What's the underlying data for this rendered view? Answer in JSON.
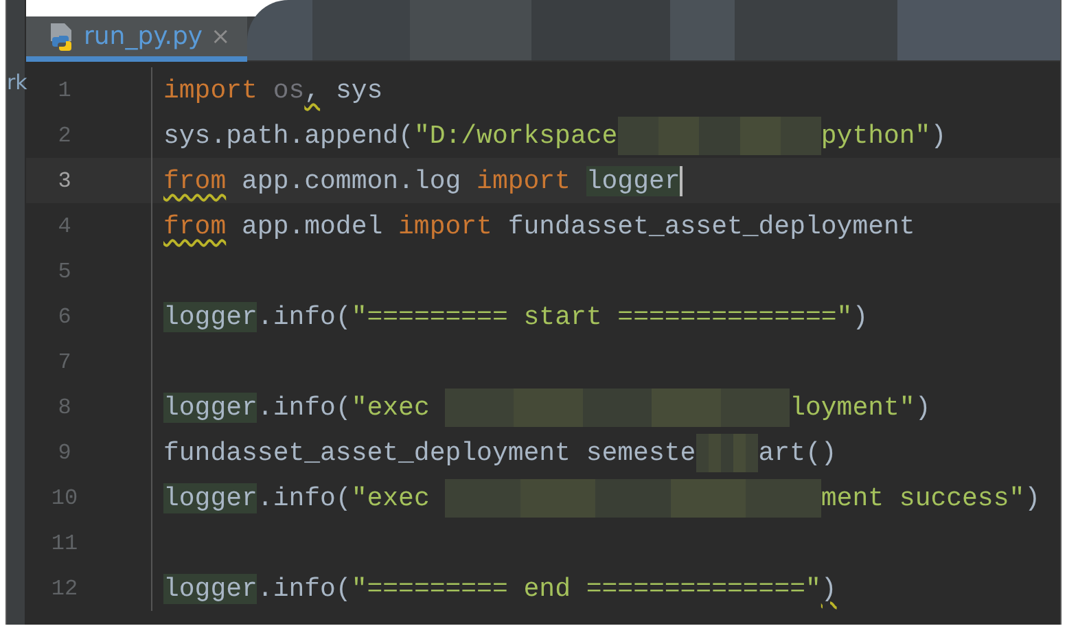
{
  "side_panel": {
    "label": "rk"
  },
  "tabs": [
    {
      "label": "run_py.py",
      "selected": true,
      "close": "×"
    }
  ],
  "editor": {
    "lines": [
      {
        "number": "1",
        "current": false,
        "tokens": [
          {
            "kind": "keyword",
            "text": "import "
          },
          {
            "kind": "unused",
            "text": "os"
          },
          {
            "kind": "plain",
            "text": ",",
            "warn": true
          },
          {
            "kind": "plain",
            "text": " sys"
          }
        ]
      },
      {
        "number": "2",
        "current": false,
        "tokens": [
          {
            "kind": "plain",
            "text": "sys.path.append("
          },
          {
            "kind": "string",
            "text": "\"D:/workspace"
          },
          {
            "kind": "blurmid"
          },
          {
            "kind": "string",
            "text": "python\""
          },
          {
            "kind": "plain",
            "text": ")"
          }
        ]
      },
      {
        "number": "3",
        "current": true,
        "tokens": [
          {
            "kind": "keyword",
            "text": "from",
            "warn": true
          },
          {
            "kind": "plain",
            "text": " app.common.log "
          },
          {
            "kind": "keyword",
            "text": "import "
          },
          {
            "kind": "plain",
            "text": "logger",
            "highlight": true,
            "cursor": true
          }
        ]
      },
      {
        "number": "4",
        "current": false,
        "tokens": [
          {
            "kind": "keyword",
            "text": "from",
            "warn": true
          },
          {
            "kind": "plain",
            "text": " app.model "
          },
          {
            "kind": "keyword",
            "text": "import"
          },
          {
            "kind": "plain",
            "text": " fundasset_asset_deployment"
          }
        ]
      },
      {
        "number": "5",
        "current": false
      },
      {
        "number": "6",
        "current": false,
        "tokens": [
          {
            "kind": "plain",
            "text": "logger",
            "highlight": true
          },
          {
            "kind": "plain",
            "text": ".info("
          },
          {
            "kind": "string",
            "text": "\"========= start ==============\""
          },
          {
            "kind": "plain",
            "text": ")"
          }
        ]
      },
      {
        "number": "7",
        "current": false
      },
      {
        "number": "8",
        "current": false,
        "tokens": [
          {
            "kind": "plain",
            "text": "logger",
            "highlight": true
          },
          {
            "kind": "plain",
            "text": ".info("
          },
          {
            "kind": "string",
            "text": "\"exec "
          },
          {
            "kind": "blurlong"
          },
          {
            "kind": "string",
            "text": "loyment\""
          },
          {
            "kind": "plain",
            "text": ")"
          }
        ]
      },
      {
        "number": "9",
        "current": false,
        "tokens": [
          {
            "kind": "plain",
            "text": "fundasset_asset_deployment semeste"
          },
          {
            "kind": "blurshort"
          },
          {
            "kind": "plain",
            "text": "art()"
          }
        ]
      },
      {
        "number": "10",
        "current": false,
        "tokens": [
          {
            "kind": "plain",
            "text": "logger",
            "highlight": true
          },
          {
            "kind": "plain",
            "text": ".info("
          },
          {
            "kind": "string",
            "text": "\"exec "
          },
          {
            "kind": "blurwide"
          },
          {
            "kind": "string",
            "text": "ment success\""
          },
          {
            "kind": "plain",
            "text": ")"
          }
        ]
      },
      {
        "number": "11",
        "current": false
      },
      {
        "number": "12",
        "current": false,
        "tokens": [
          {
            "kind": "plain",
            "text": "logger",
            "highlight": true
          },
          {
            "kind": "plain",
            "text": ".info("
          },
          {
            "kind": "string",
            "text": "\"========= end ==============\""
          },
          {
            "kind": "plain",
            "text": ")",
            "warn": true
          }
        ]
      }
    ]
  }
}
